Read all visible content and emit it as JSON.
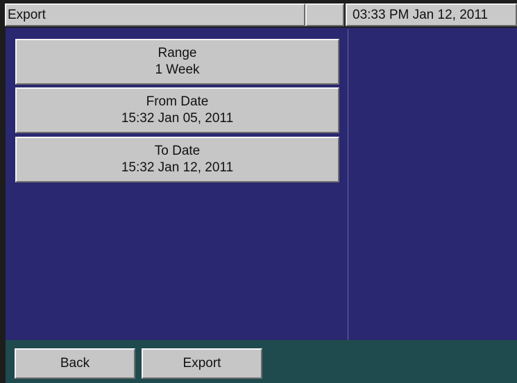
{
  "header": {
    "title": "Export",
    "clock": "03:33 PM Jan 12, 2011"
  },
  "fields": [
    {
      "label": "Range",
      "value": "1 Week"
    },
    {
      "label": "From Date",
      "value": "15:32 Jan 05, 2011"
    },
    {
      "label": "To Date",
      "value": "15:32 Jan 12, 2011"
    }
  ],
  "footer": {
    "back_label": "Back",
    "export_label": "Export"
  },
  "colors": {
    "panel_background": "#2a2870",
    "footer_background": "#1f4a4e",
    "button_face": "#c6c6c6"
  }
}
